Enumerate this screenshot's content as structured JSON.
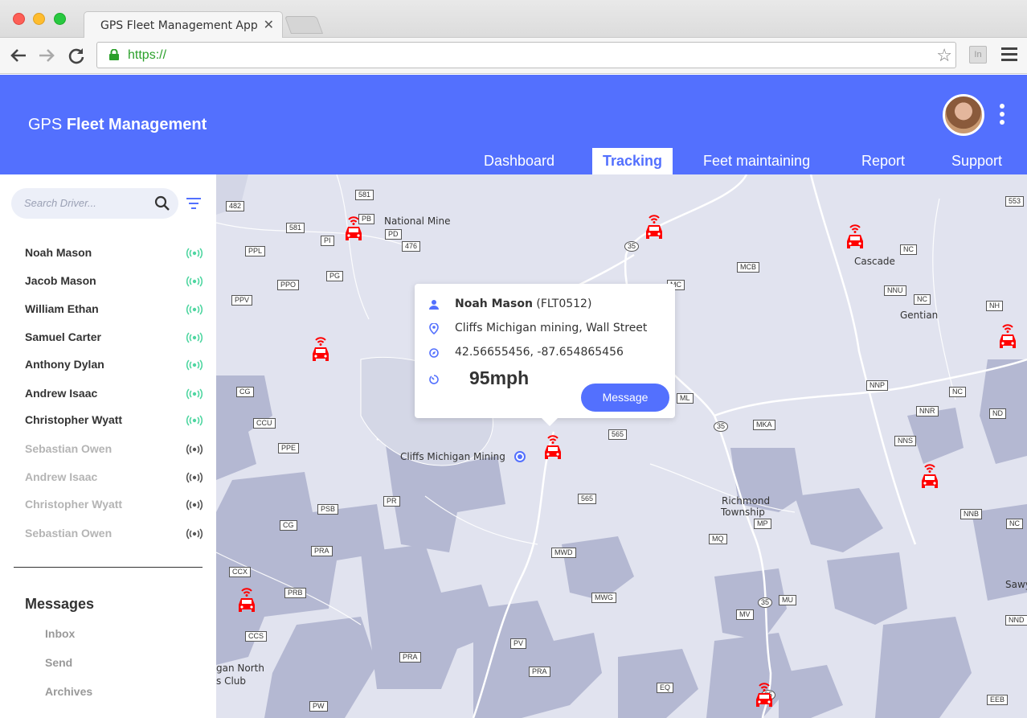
{
  "browser": {
    "tab_title": "GPS Fleet Management App",
    "tab_close": "✕",
    "url": "https://",
    "ext_label": "In"
  },
  "app": {
    "title_prefix": "GPS",
    "title_strong": "Fleet Management"
  },
  "nav": {
    "items": [
      {
        "label": "Dashboard",
        "active": false
      },
      {
        "label": "Tracking",
        "active": true
      },
      {
        "label": "Feet maintaining",
        "active": false
      },
      {
        "label": "Report",
        "active": false
      },
      {
        "label": "Support",
        "active": false
      }
    ]
  },
  "sidebar": {
    "search_placeholder": "Search Driver...",
    "drivers": [
      {
        "name": "Noah Mason",
        "online": true
      },
      {
        "name": "Jacob Mason",
        "online": true
      },
      {
        "name": "William Ethan",
        "online": true
      },
      {
        "name": "Samuel Carter",
        "online": true
      },
      {
        "name": "Anthony Dylan",
        "online": true
      },
      {
        "name": "Andrew Isaac",
        "online": true
      },
      {
        "name": "Christopher Wyatt",
        "online": true
      },
      {
        "name": "Sebastian Owen",
        "online": false
      },
      {
        "name": "Andrew Isaac",
        "online": false
      },
      {
        "name": "Christopher Wyatt",
        "online": false
      },
      {
        "name": "Sebastian Owen",
        "online": false
      }
    ],
    "messages_title": "Messages",
    "messages_items": [
      "Inbox",
      "Send",
      "Archives"
    ]
  },
  "popup": {
    "driver_name": "Noah Mason",
    "fleet_id": "(FLT0512)",
    "location": "Cliffs Michigan mining, Wall Street",
    "coordinates": "42.56655456, -87.654865456",
    "speed": "95mph",
    "button_label": "Message"
  },
  "map": {
    "places": [
      "National Mine",
      "Cascade",
      "Gentian",
      "Cliffs Michigan Mining",
      "Richmond",
      "Township",
      "Sawyer",
      "gan North",
      "s Club"
    ],
    "routes": [
      "581",
      "482",
      "PB",
      "581",
      "PD",
      "476",
      "PI",
      "PPL",
      "PG",
      "PPO",
      "PPV",
      "35",
      "MCB",
      "NC",
      "NNU",
      "NC",
      "NH",
      "MC",
      "553",
      "CG",
      "CCU",
      "PPE",
      "ML",
      "35",
      "MKA",
      "NNP",
      "NC",
      "NNR",
      "NNS",
      "ND",
      "565",
      "PSB",
      "PR",
      "565",
      "CG",
      "PRA",
      "MWD",
      "MQ",
      "MP",
      "NNB",
      "NC",
      "CCX",
      "PRB",
      "MWG",
      "35",
      "MU",
      "MV",
      "NND",
      "CCS",
      "PV",
      "PRA",
      "PRA",
      "EQ",
      "EEB",
      "PW",
      "35"
    ],
    "colors": {
      "background": "#e1e3ef",
      "land": "#b4b8d2",
      "road": "#ffffff",
      "car": "#ff0000",
      "accent": "#5370fe",
      "signal_online": "#4fd6a1",
      "signal_offline": "#555555"
    }
  }
}
